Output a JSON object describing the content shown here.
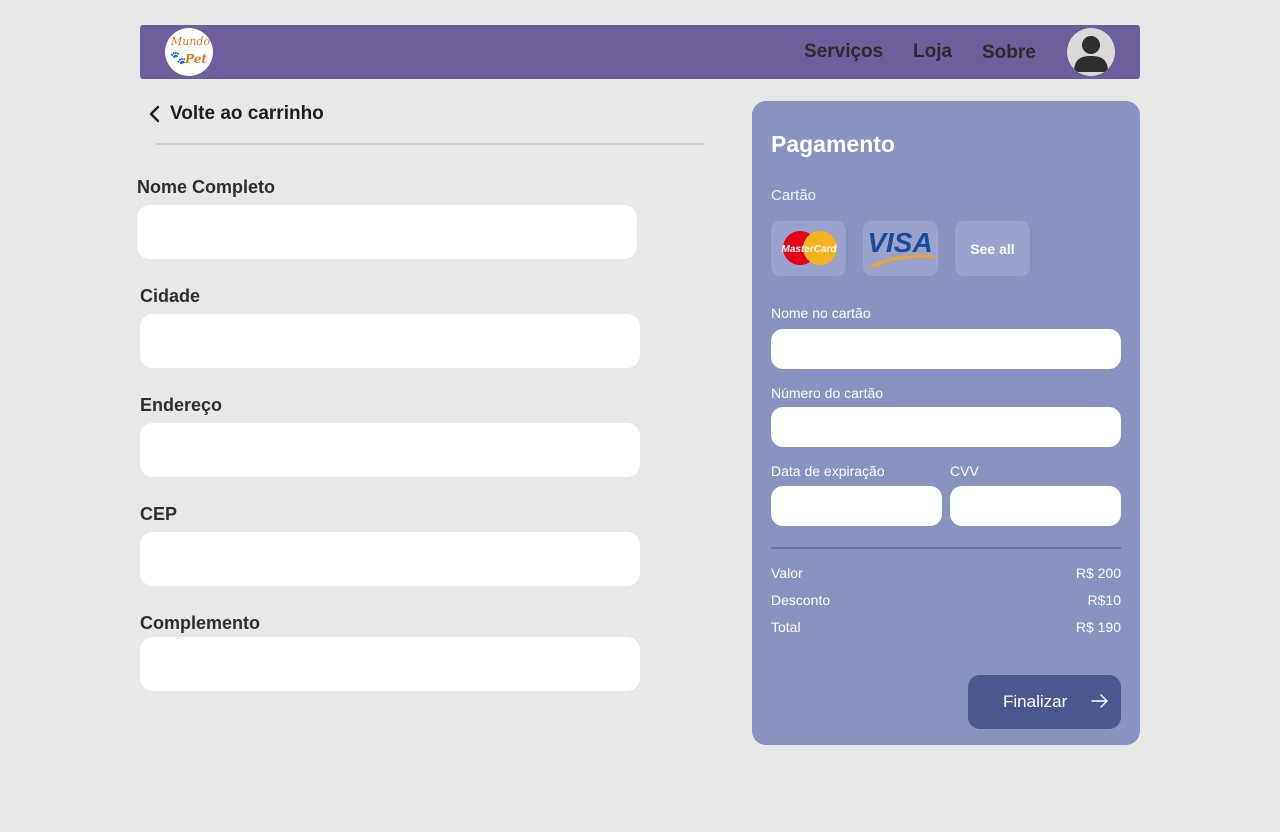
{
  "header": {
    "logo_text_top": "Mundo",
    "logo_text_bottom": "Pet",
    "nav": [
      "Serviços",
      "Loja",
      "Sobre"
    ]
  },
  "back_link": {
    "label": "Volte ao carrinho"
  },
  "form": {
    "fields": [
      {
        "label": "Nome Completo",
        "value": ""
      },
      {
        "label": "Cidade",
        "value": ""
      },
      {
        "label": "Endereço",
        "value": ""
      },
      {
        "label": "CEP",
        "value": ""
      },
      {
        "label": "Complemento",
        "value": ""
      }
    ]
  },
  "payment": {
    "title": "Pagamento",
    "card_label": "Cartão",
    "card_brands": {
      "mastercard": "MasterCard",
      "visa": "VISA"
    },
    "see_all": "See all",
    "name_label": "Nome no cartão",
    "number_label": "Número do cartão",
    "expiry_label": "Data de expiração",
    "cvv_label": "CVV",
    "summary": [
      {
        "label": "Valor",
        "value": "R$ 200"
      },
      {
        "label": "Desconto",
        "value": "R$10"
      },
      {
        "label": "Total",
        "value": "R$ 190"
      }
    ],
    "finalize_label": "Finalizar"
  },
  "colors": {
    "header": "#6e5e9c",
    "panel": "#8893c0",
    "button": "#4b5890",
    "background": "#e8e8e8"
  },
  "icons": {
    "back": "chevron-left-icon",
    "avatar": "user-icon",
    "finalize": "arrow-right-icon"
  }
}
